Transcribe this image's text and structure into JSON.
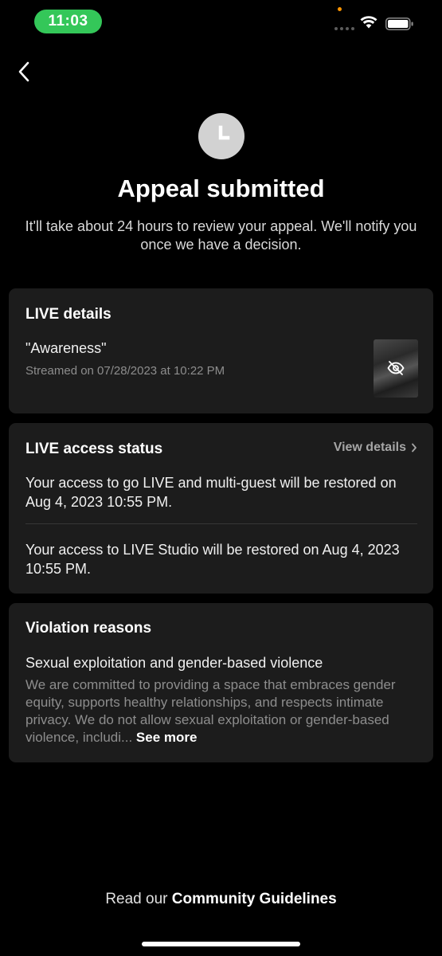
{
  "status_bar": {
    "time": "11:03",
    "time_pill_color": "#34c759",
    "icons": [
      "signal-icon",
      "wifi-icon",
      "battery-icon"
    ]
  },
  "header": {
    "icon": "clock-icon",
    "title": "Appeal submitted",
    "subtitle": "It'll take about 24 hours to review your appeal. We'll notify you once we have a decision."
  },
  "live_details": {
    "title": "LIVE details",
    "stream_name": "\"Awareness\"",
    "streamed_on": "Streamed on 07/28/2023 at 10:22 PM",
    "thumbnail_icon": "hidden-eye-icon"
  },
  "access_status": {
    "title": "LIVE access status",
    "view_details": "View details",
    "items": [
      "Your access to go LIVE and multi-guest will be restored on Aug 4, 2023 10:55 PM.",
      "Your access to LIVE Studio will be restored on Aug 4, 2023 10:55 PM."
    ]
  },
  "violation": {
    "title": "Violation reasons",
    "reason": "Sexual exploitation and gender-based violence",
    "description": "We are committed to providing a space that embraces gender equity, supports healthy relationships, and respects intimate privacy. We do not allow sexual exploitation or gender-based violence, includi...",
    "see_more": "See more"
  },
  "footer": {
    "prefix": "Read our",
    "link": "Community Guidelines"
  },
  "colors": {
    "background": "#000000",
    "card": "#1c1c1c",
    "muted_text": "#8d8d8d"
  }
}
